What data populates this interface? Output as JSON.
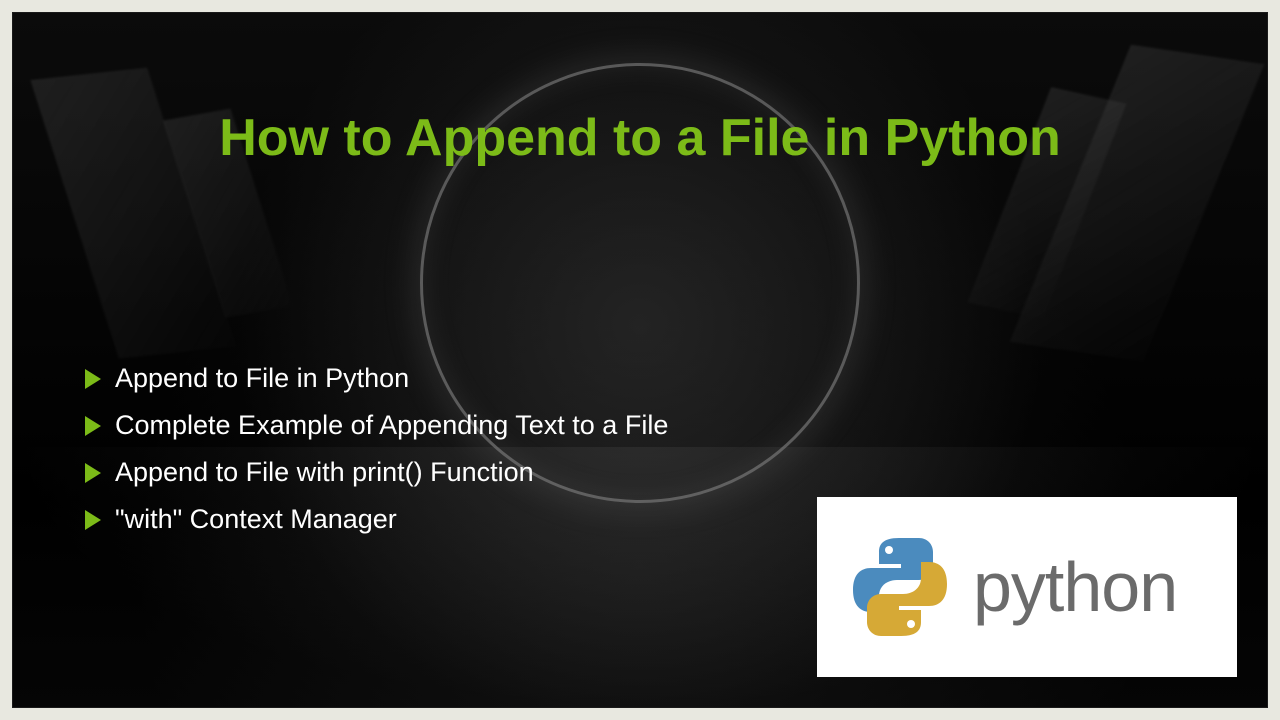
{
  "title": "How to Append to a File in Python",
  "bullets": [
    "Append to File in Python",
    "Complete Example of Appending Text to a File",
    "Append to File with print() Function",
    "\"with\" Context Manager"
  ],
  "logo": {
    "text": "python",
    "colors": {
      "blue": "#4b8bbe",
      "yellow": "#d6a936"
    }
  },
  "accent_color": "#7cbb18"
}
